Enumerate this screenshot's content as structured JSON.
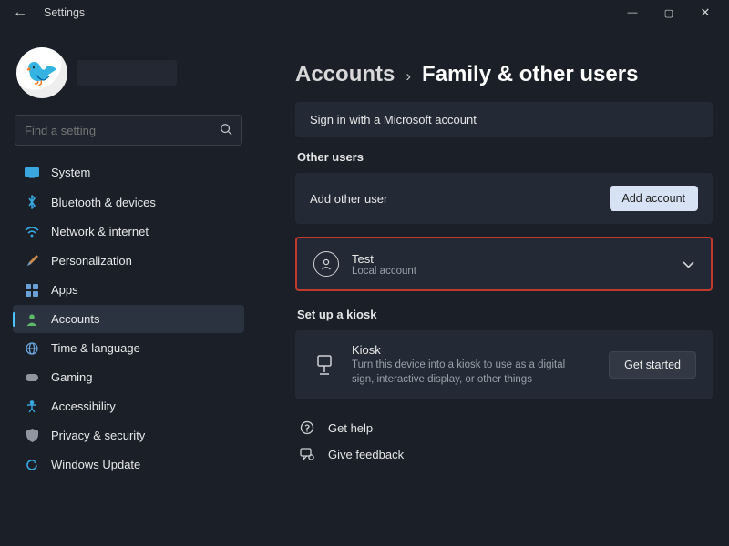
{
  "window": {
    "title": "Settings"
  },
  "profile": {
    "avatar_emoji": "🐦"
  },
  "search": {
    "placeholder": "Find a setting"
  },
  "sidebar": {
    "items": [
      {
        "icon": "🖥️",
        "label": "System"
      },
      {
        "icon": "B",
        "label": "Bluetooth & devices",
        "icon_type": "bt"
      },
      {
        "icon": "📶",
        "label": "Network & internet",
        "icon_type": "wifi"
      },
      {
        "icon": "🖌️",
        "label": "Personalization"
      },
      {
        "icon": "▦",
        "label": "Apps",
        "icon_type": "apps"
      },
      {
        "icon": "👤",
        "label": "Accounts",
        "selected": true
      },
      {
        "icon": "🌐",
        "label": "Time & language"
      },
      {
        "icon": "🎮",
        "label": "Gaming"
      },
      {
        "icon": "✶",
        "label": "Accessibility",
        "icon_type": "access"
      },
      {
        "icon": "🛡️",
        "label": "Privacy & security"
      },
      {
        "icon": "🔄",
        "label": "Windows Update"
      }
    ]
  },
  "breadcrumb": {
    "parent": "Accounts",
    "sep": "›",
    "current": "Family & other users"
  },
  "banner": {
    "text": "Sign in with a Microsoft account"
  },
  "other_users": {
    "heading": "Other users",
    "add_label": "Add other user",
    "add_button": "Add account",
    "list": [
      {
        "name": "Test",
        "type": "Local account"
      }
    ]
  },
  "kiosk": {
    "heading": "Set up a kiosk",
    "title": "Kiosk",
    "desc": "Turn this device into a kiosk to use as a digital sign, interactive display, or other things",
    "button": "Get started"
  },
  "footer": {
    "help": "Get help",
    "feedback": "Give feedback"
  }
}
